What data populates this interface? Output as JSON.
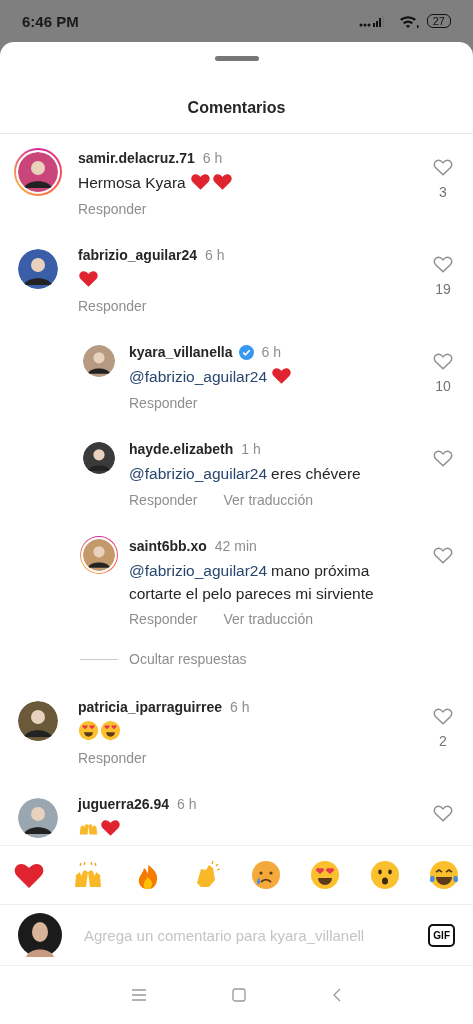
{
  "status_bar": {
    "time": "6:46 PM",
    "battery": "27"
  },
  "sheet": {
    "title": "Comentarios"
  },
  "comments": [
    {
      "user": "samir.delacruz.71",
      "time": "6 h",
      "verified": false,
      "story_ring": true,
      "text": "Hermosa Kyara",
      "emoji": [
        {
          "kind": "heart"
        },
        {
          "kind": "heart"
        }
      ],
      "actions": [
        "Responder"
      ],
      "likes": "3"
    },
    {
      "user": "fabrizio_aguilar24",
      "time": "6 h",
      "verified": false,
      "story_ring": false,
      "emoji": [
        {
          "kind": "heart"
        }
      ],
      "actions": [
        "Responder"
      ],
      "likes": "19",
      "hide_replies": "Ocultar respuestas",
      "children": [
        {
          "user": "kyara_villanella",
          "time": "6 h",
          "verified": true,
          "story_ring": false,
          "mention": "@fabrizio_aguilar24",
          "emoji": [
            {
              "kind": "heart"
            }
          ],
          "actions": [
            "Responder"
          ],
          "likes": "10"
        },
        {
          "user": "hayde.elizabeth",
          "time": "1 h",
          "verified": false,
          "story_ring": false,
          "mention": "@fabrizio_aguilar24",
          "text": "eres chévere",
          "actions": [
            "Responder",
            "Ver traducción"
          ]
        },
        {
          "user": "saint6bb.xo",
          "time": "42 min",
          "verified": false,
          "story_ring": true,
          "mention": "@fabrizio_aguilar24",
          "text": "mano próxima cortarte el pelo pareces mi sirviente",
          "actions": [
            "Responder",
            "Ver traducción"
          ]
        }
      ]
    },
    {
      "user": "patricia_iparraguirree",
      "time": "6 h",
      "verified": false,
      "story_ring": false,
      "emoji": [
        {
          "kind": "heart-eyes"
        },
        {
          "kind": "heart-eyes"
        }
      ],
      "actions": [
        "Responder"
      ],
      "likes": "2"
    },
    {
      "user": "juguerra26.94",
      "time": "6 h",
      "verified": false,
      "story_ring": false,
      "emoji": [
        {
          "kind": "raised-hands"
        },
        {
          "kind": "heart"
        }
      ]
    }
  ],
  "emoji_bar": [
    {
      "kind": "heart"
    },
    {
      "kind": "raised-hands"
    },
    {
      "kind": "fire"
    },
    {
      "kind": "clap"
    },
    {
      "kind": "crying"
    },
    {
      "kind": "heart-eyes"
    },
    {
      "kind": "surprised"
    },
    {
      "kind": "joy"
    }
  ],
  "composer": {
    "placeholder": "Agrega un comentario para kyara_villanell",
    "gif": "GIF"
  }
}
